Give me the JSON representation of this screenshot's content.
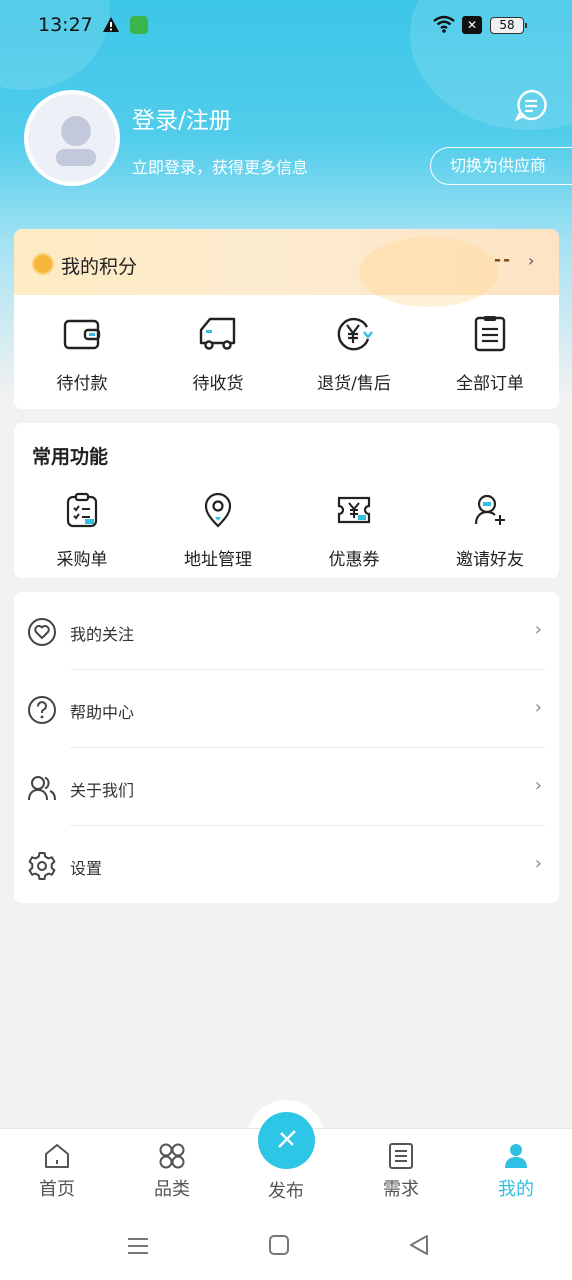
{
  "status_bar": {
    "time": "13:27",
    "battery": "58",
    "icons": [
      "warning-icon",
      "shield-icon",
      "wifi-icon",
      "x-icon",
      "battery-icon"
    ]
  },
  "profile": {
    "title": "登录/注册",
    "subtitle": "立即登录，获得更多信息",
    "switch_label": "切换为供应商",
    "message_icon": "message-icon",
    "avatar_icon": "user-icon"
  },
  "points": {
    "label": "我的积分",
    "value": "--",
    "arrow": "›",
    "icon": "coin-icon"
  },
  "orders": [
    {
      "label": "待付款",
      "icon": "wallet-icon"
    },
    {
      "label": "待收货",
      "icon": "truck-icon"
    },
    {
      "label": "退货/售后",
      "icon": "yen-refund-icon"
    },
    {
      "label": "全部订单",
      "icon": "order-list-icon"
    }
  ],
  "functions": {
    "title": "常用功能",
    "items": [
      {
        "label": "采购单",
        "icon": "clipboard-icon"
      },
      {
        "label": "地址管理",
        "icon": "location-icon"
      },
      {
        "label": "优惠券",
        "icon": "coupon-icon"
      },
      {
        "label": "邀请好友",
        "icon": "invite-user-icon"
      }
    ]
  },
  "menu": [
    {
      "label": "我的关注",
      "icon": "heart-icon"
    },
    {
      "label": "帮助中心",
      "icon": "help-icon"
    },
    {
      "label": "关于我们",
      "icon": "users-icon"
    },
    {
      "label": "设置",
      "icon": "gear-icon"
    }
  ],
  "chevron": "›",
  "tabbar": [
    {
      "label": "首页",
      "icon": "home-icon",
      "active": false
    },
    {
      "label": "品类",
      "icon": "category-icon",
      "active": false
    },
    {
      "label": "发布",
      "icon": "publish-icon",
      "active": false
    },
    {
      "label": "需求",
      "icon": "demand-icon",
      "active": false
    },
    {
      "label": "我的",
      "icon": "profile-icon",
      "active": true
    }
  ],
  "colors": {
    "accent": "#2fc0e4",
    "header": "#3cc6e8",
    "points_bar": "#fdebc3",
    "background": "#f2f2f2"
  }
}
